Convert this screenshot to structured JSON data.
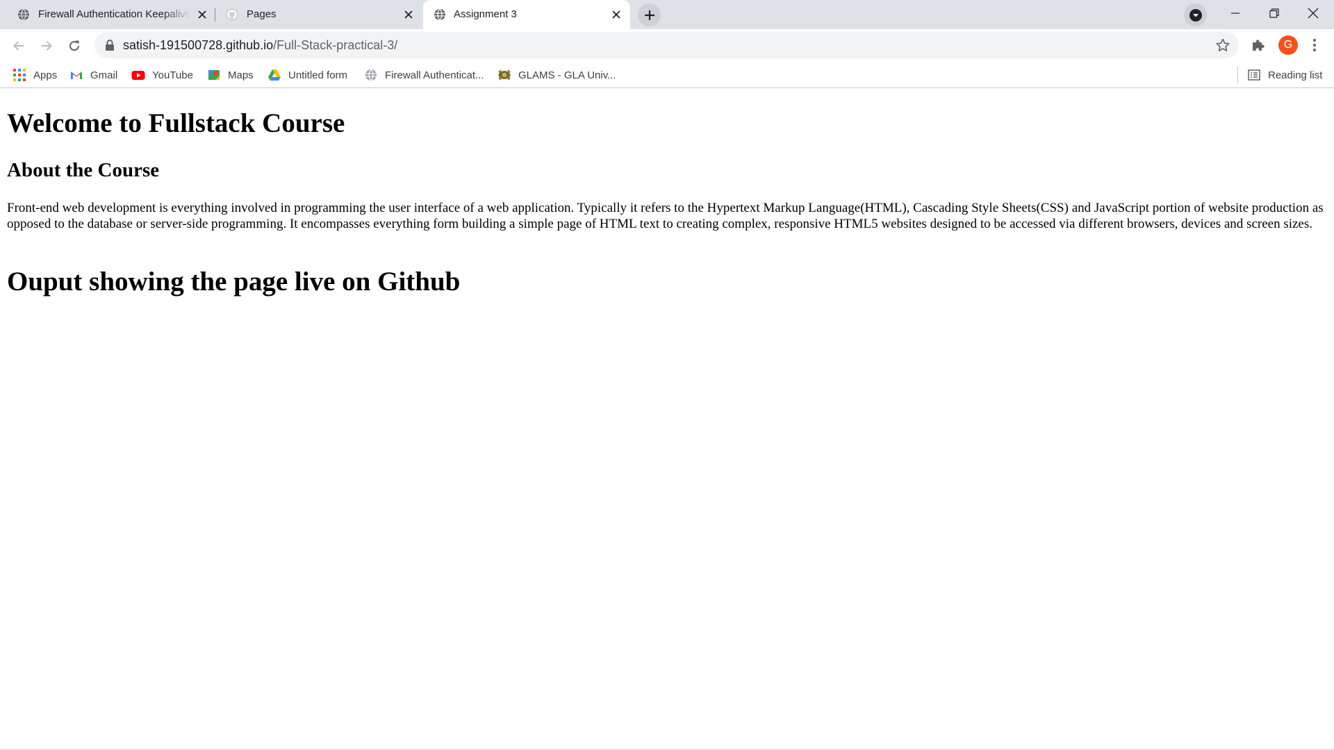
{
  "browser": {
    "tabs": [
      {
        "title": "Firewall Authentication Keepalive",
        "favicon": "globe-icon",
        "active": false
      },
      {
        "title": "Pages",
        "favicon": "github-icon",
        "active": false
      },
      {
        "title": "Assignment 3",
        "favicon": "globe-icon",
        "active": true
      }
    ],
    "address_bar": {
      "host": "satish-191500728.github.io",
      "path": "/Full-Stack-practical-3/"
    },
    "profile_initial": "G",
    "profile_color": "#f4511e",
    "bookmarks": [
      {
        "label": "Apps",
        "icon": "apps-grid-icon"
      },
      {
        "label": "Gmail",
        "icon": "gmail-icon"
      },
      {
        "label": "YouTube",
        "icon": "youtube-icon"
      },
      {
        "label": "Maps",
        "icon": "maps-icon"
      },
      {
        "label": "Untitled form",
        "icon": "google-drive-icon"
      },
      {
        "label": "Firewall Authenticat...",
        "icon": "globe-icon"
      },
      {
        "label": "GLAMS - GLA Univ...",
        "icon": "gla-logo-icon"
      }
    ],
    "reading_list_label": "Reading list"
  },
  "page": {
    "heading": "Welcome to Fullstack Course",
    "subheading": "About the Course",
    "paragraph": "Front-end web development is everything involved in programming the user interface of a web application. Typically it refers to the Hypertext Markup Language(HTML), Cascading Style Sheets(CSS) and JavaScript portion of website production as opposed to the database or server-side programming. It encompasses everything form building a simple page of HTML text to creating complex, responsive HTML5 websites designed to be accessed via different browsers, devices and screen sizes.",
    "heading2": "Ouput showing the page live on Github"
  }
}
